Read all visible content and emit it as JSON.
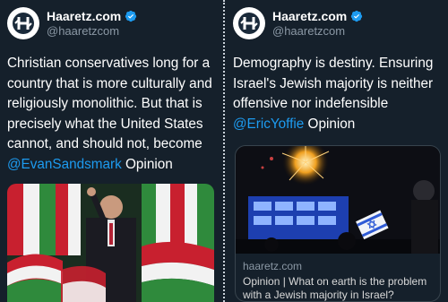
{
  "tweets": [
    {
      "account_name": "Haaretz.com",
      "account_handle": "@haaretzcom",
      "text_main": "Christian conservatives long for a country that is more culturally and religiously monolithic. But that is precisely what the United States cannot, and should not, become",
      "mention": "@EvanSandsmark",
      "text_tail": " Opinion"
    },
    {
      "account_name": "Haaretz.com",
      "account_handle": "@haaretzcom",
      "text_main": "Demography is destiny. Ensuring Israel's Jewish majority is neither offensive nor indefensible",
      "mention": "@EricYoffie",
      "text_tail": " Opinion",
      "card": {
        "domain": "haaretz.com",
        "title": "Opinion | What on earth is the problem with a Jewish majority in Israel?"
      }
    }
  ],
  "colors": {
    "background": "#15202b",
    "mention": "#1d9bf0",
    "verified": "#1d9bf0",
    "secondary_text": "#8b98a5"
  },
  "icons": {
    "avatar": "haaretz-logo-icon",
    "verified": "verified-badge-icon"
  }
}
